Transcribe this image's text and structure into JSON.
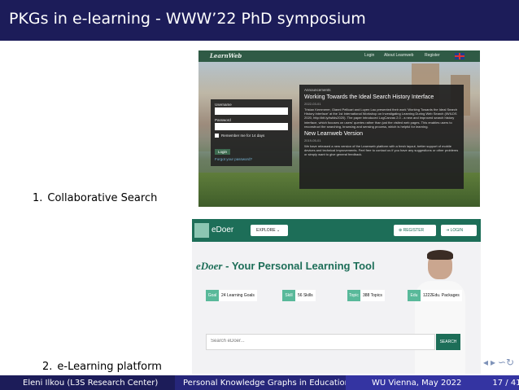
{
  "slide": {
    "title": "PKGs in e-learning - WWW’22 PhD symposium"
  },
  "figures": [
    {
      "caption_number": "1.",
      "caption_text": "Collaborative Search"
    },
    {
      "caption_number": "2.",
      "caption_text": "e-Learning platform"
    }
  ],
  "learnweb": {
    "logo": "LearnWeb",
    "nav": [
      "Login",
      "About Learnweb",
      "Register"
    ],
    "login_form": {
      "username_label": "Username",
      "password_label": "Password",
      "remember_label": "Remember me for 14 days",
      "login_button": "Login",
      "forgot_link": "Forgot your password?"
    },
    "news": {
      "header": "Announcements",
      "items": [
        {
          "title": "Working Towards the Ideal Search History Interface",
          "date": "2022-03-01",
          "body": "Tristan Kemmerer, Gianni Pellicari and Luyen Lau presented their work 'Working Towards the Ideal Search History Interface' at the 1st International Workshop on Investigating Learning During Web Search (IWILDS 2020, http://bit.ly/iwilds2020). The paper introduced LogCanvas 2.0 - a new and improved search history interface, which focuses on users' queries rather than just the visited web pages. This enables users to reconstruct the searching, browsing and sensing process, which is helpful for learning."
        },
        {
          "title": "New Learnweb Version",
          "date": "2019-05-01",
          "body": "We have released a new version of the Learnweb platform with a fresh layout, better support of mobile devices and technical improvements. Feel free to contact us if you have any suggestions or other problems or simply want to give general feedback."
        }
      ]
    }
  },
  "edoer": {
    "logo": "eDoer",
    "explore": "EXPLORE",
    "register": "REGISTER",
    "login": "LOGIN",
    "tagline_brand": "eDoer",
    "tagline_rest": " - Your Personal Learning Tool",
    "stats": [
      {
        "icon_text": "Goal",
        "label": "24 Learning Goals"
      },
      {
        "icon_text": "Skill",
        "label": "56 Skills"
      },
      {
        "icon_text": "Topic",
        "label": "388 Topics"
      },
      {
        "icon_text": "Edu",
        "label": "1222Edu. Packages"
      }
    ],
    "search_placeholder": "Search eDoer...",
    "search_button": "SEARCH"
  },
  "nav_symbols": [
    "◂",
    "▸",
    "↻",
    "∽",
    "♢"
  ],
  "footer": {
    "author": "Eleni Ilkou  (L3S Research Center)",
    "talk": "Personal Knowledge Graphs in Education",
    "venue": "WU Vienna, May 2022",
    "page": "17 / 41"
  },
  "colors": {
    "header_bg": "#1c1c59",
    "footer_dark": "#1c1c59",
    "footer_mid": "#2a2a7a",
    "footer_light": "#3a3aa0",
    "edoer_green": "#1d6e58",
    "learnweb_green": "#2f5a45"
  }
}
